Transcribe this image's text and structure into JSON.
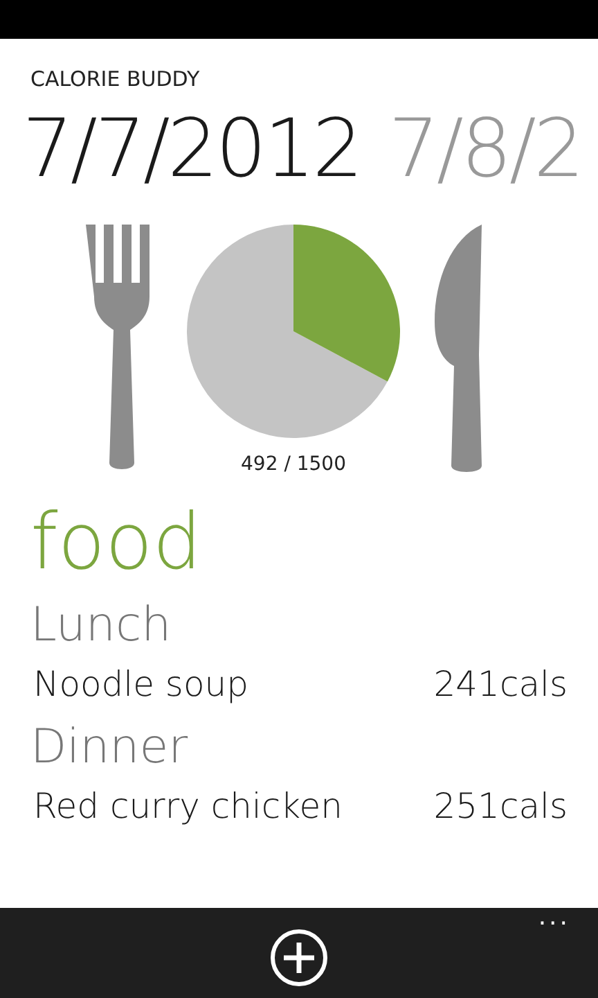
{
  "app_title": "CALORIE BUDDY",
  "pivots": [
    {
      "label": "7/7/2012",
      "selected": true
    },
    {
      "label": "7/8/2",
      "selected": false
    }
  ],
  "intake": {
    "reading": "492 / 1500"
  },
  "section_title": "food",
  "meals": [
    {
      "name": "Lunch",
      "items": [
        {
          "name": "Noodle soup",
          "calories": "241cals"
        }
      ]
    },
    {
      "name": "Dinner",
      "items": [
        {
          "name": "Red curry chicken",
          "calories": "251cals"
        }
      ]
    }
  ],
  "app_bar": {
    "more": "..."
  }
}
